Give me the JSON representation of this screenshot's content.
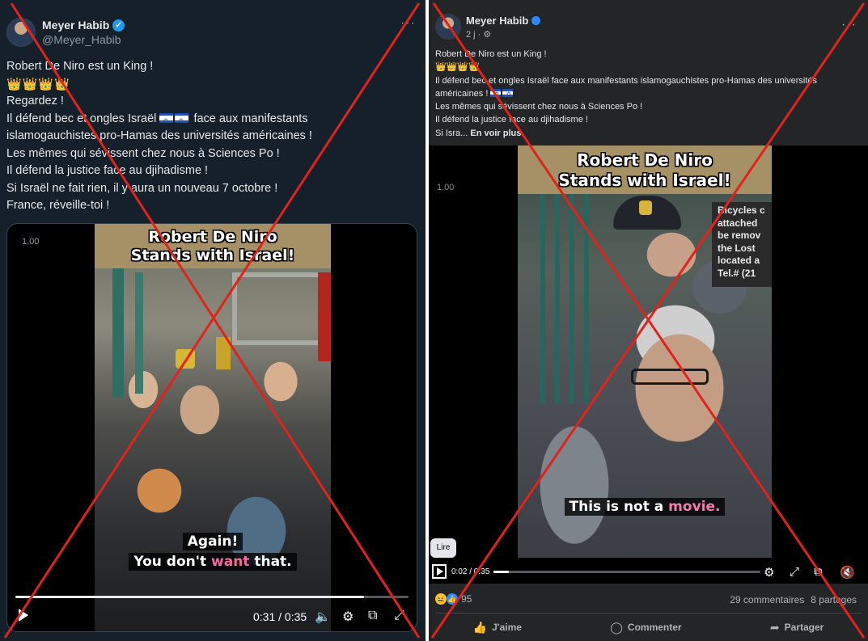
{
  "left_post": {
    "author_name": "Meyer Habib",
    "handle": "@Meyer_Habib",
    "more": "···",
    "text_lines": [
      "Robert De Niro est un King !",
      "",
      "Regardez !",
      "Il défend bec et ongles Israël",
      "face aux manifestants",
      "islamogauchistes pro-Hamas des universités américaines !",
      "Les mêmes qui sévissent chez nous à Sciences Po !",
      "Il défend la justice face au djihadisme !",
      "Si Israël ne fait rien, il y aura un nouveau 7 octobre !",
      "France, réveille-toi !"
    ],
    "crowns": "👑👑👑👑",
    "video": {
      "speed": "1.00",
      "banner_line1": "Robert De Niro",
      "banner_line2": "Stands with Israel!",
      "caption_line1": "Again!",
      "caption_pre": "You don't ",
      "caption_highlight": "want",
      "caption_post": " that.",
      "time": "0:31 / 0:35",
      "progress": 0.886
    }
  },
  "right_post": {
    "author_name": "Meyer Habib",
    "meta": "2 j · ⚙",
    "more": "···",
    "text_lines": [
      "Robert De Niro est un King !",
      "",
      "Il défend bec et ongles Israël face aux manifestants islamogauchistes pro-Hamas des universités",
      "américaines !",
      "Les mêmes qui sévissent chez nous à Sciences Po !",
      "Il défend la justice face au djihadisme !",
      "Si Isra..."
    ],
    "see_more": "En voir plus",
    "crowns": "👑👑👑👑",
    "video": {
      "speed": "1.00",
      "banner_line1": "Robert De Niro",
      "banner_line2": "Stands with Israel!",
      "sign_lines": [
        "Bicycles c",
        "attached",
        "be remov",
        "the Lost",
        "located a",
        "Tel.# (21"
      ],
      "caption_pre": "This is not a ",
      "caption_highlight": "movie.",
      "tooltip": "Lire",
      "time": "0:02 / 0:35",
      "progress": 0.057
    },
    "reaction_count": "95",
    "comments": "29 commentaires",
    "shares": "8 partages",
    "actions": {
      "like": "J'aime",
      "comment": "Commenter",
      "share": "Partager"
    }
  },
  "colors": {
    "x_mark": "#e0231c",
    "twitter_bg": "#15202b",
    "facebook_bg": "#242526",
    "banner": "#a69066",
    "caption_highlight": "#f06c9b"
  }
}
